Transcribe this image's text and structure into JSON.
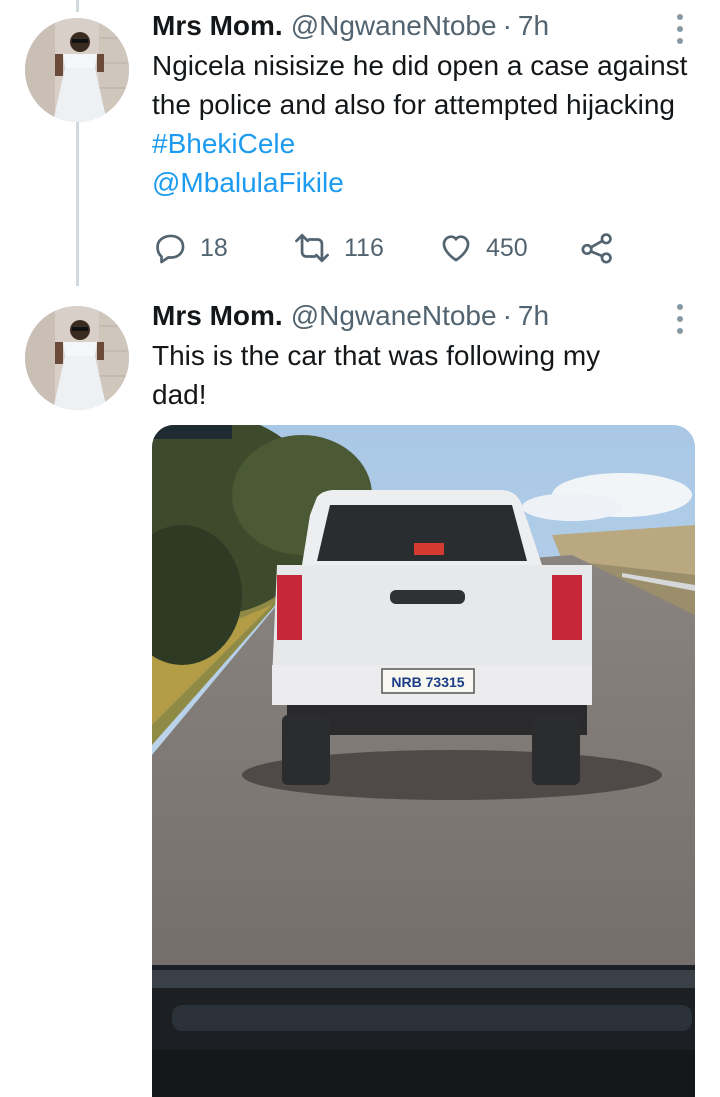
{
  "tweets": [
    {
      "author_name": "Mrs Mom.",
      "author_handle": "@NgwaneNtobe",
      "separator": "·",
      "time": "7h",
      "text_plain": "Ngicela nisisize he did open a case against the police and also for attempted hijacking ",
      "hashtag": "#BhekiCele",
      "mention": "@MbalulaFikile",
      "replies": "18",
      "retweets": "116",
      "likes": "450"
    },
    {
      "author_name": "Mrs Mom.",
      "author_handle": "@NgwaneNtobe",
      "separator": "·",
      "time": "7h",
      "text_plain": "This is the car that was following my dad!",
      "media": {
        "plate_text": "NRB 73315"
      }
    }
  ],
  "colors": {
    "link": "#1d9bf0",
    "secondary_text": "#536471",
    "thread_line": "#cfd9de"
  }
}
